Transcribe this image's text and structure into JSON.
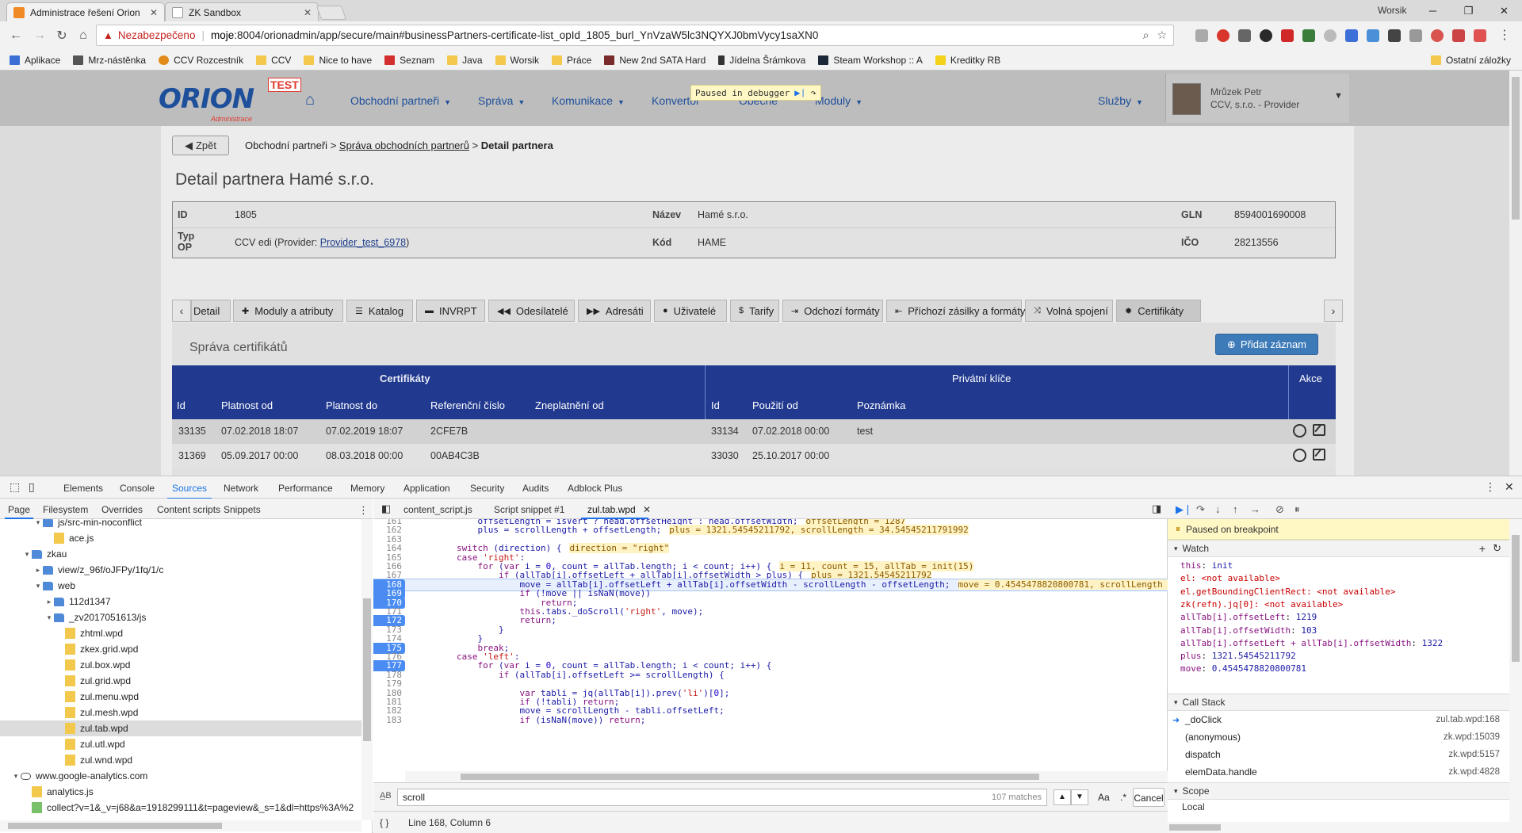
{
  "browser": {
    "tabs": [
      {
        "title": "Administrace řešení Orion",
        "active": true
      },
      {
        "title": "ZK Sandbox",
        "active": false
      }
    ],
    "profile": "Worsik",
    "omnibox": {
      "security_label": "Nezabezpečeno",
      "url_host": "moje",
      "url_rest": ":8004/orionadmin/app/secure/main#businessPartners-certificate-list_opId_1805_burl_YnVzaW5lc3NQYXJ0bmVycy1saXN0"
    },
    "bookmarks": [
      {
        "label": "Aplikace",
        "icon": "apps-icon"
      },
      {
        "label": "Mrz-nástěnka",
        "icon": "pin-icon"
      },
      {
        "label": "CCV Rozcestník",
        "icon": "ccv-icon"
      },
      {
        "label": "CCV",
        "icon": "folder-icon"
      },
      {
        "label": "Nice to have",
        "icon": "folder-icon"
      },
      {
        "label": "Seznam",
        "icon": "seznam-icon"
      },
      {
        "label": "Java",
        "icon": "folder-icon"
      },
      {
        "label": "Worsik",
        "icon": "folder-icon"
      },
      {
        "label": "Práce",
        "icon": "folder-icon"
      },
      {
        "label": "New 2nd SATA Hard",
        "icon": "store-icon"
      },
      {
        "label": "Jídelna Šrámkova",
        "icon": "fork-icon"
      },
      {
        "label": "Steam Workshop :: A",
        "icon": "steam-icon"
      },
      {
        "label": "Kreditky RB",
        "icon": "rb-icon"
      }
    ],
    "other_bookmarks": "Ostatní záložky"
  },
  "app": {
    "logo_text": "ORION",
    "logo_badge": "TEST",
    "logo_sub": "Administrace",
    "menu": [
      {
        "label": "Obchodní partneři"
      },
      {
        "label": "Správa"
      },
      {
        "label": "Komunikace"
      },
      {
        "label": "Konvertor"
      },
      {
        "label": "Obecné"
      },
      {
        "label": "Moduly"
      },
      {
        "label": "Služby"
      }
    ],
    "debugger_overlay": "Paused in debugger",
    "user": {
      "name": "Mrůzek Petr",
      "company": "CCV, s.r.o. - Provider"
    },
    "back_label": "Zpět",
    "breadcrumb": {
      "a": "Obchodní partneři",
      "sep1": " > ",
      "b": "Správa obchodních partnerů",
      "sep2": " > ",
      "c": "Detail partnera"
    },
    "page_title": "Detail partnera Hamé s.r.o.",
    "info": {
      "id_label": "ID",
      "id_value": "1805",
      "name_label": "Název",
      "name_value": "Hamé s.r.o.",
      "gln_label": "GLN",
      "gln_value": "8594001690008",
      "type_label": "Typ OP",
      "type_value": "CCV edi (Provider: ",
      "type_link": "Provider_test_6978",
      "type_end": ")",
      "code_label": "Kód",
      "code_value": "HAME",
      "ico_label": "IČO",
      "ico_value": "28213556"
    },
    "tabs": [
      {
        "label": "Detail",
        "icon": "info-icon"
      },
      {
        "label": "Moduly a atributy",
        "icon": "puzzle-icon"
      },
      {
        "label": "Katalog",
        "icon": "list-icon"
      },
      {
        "label": "INVRPT",
        "icon": "inbox-icon"
      },
      {
        "label": "Odesílatelé",
        "icon": "backward-icon"
      },
      {
        "label": "Adresáti",
        "icon": "forward-icon"
      },
      {
        "label": "Uživatelé",
        "icon": "user-icon"
      },
      {
        "label": "Tarify",
        "icon": "dollar-icon"
      },
      {
        "label": "Odchozí formáty",
        "icon": "signout-icon"
      },
      {
        "label": "Příchozí zásilky a formáty",
        "icon": "signin-icon"
      },
      {
        "label": "Volná spojení",
        "icon": "shuffle-icon"
      },
      {
        "label": "Certifikáty",
        "icon": "cert-icon"
      }
    ],
    "cert": {
      "title": "Správa certifikátů",
      "add_label": "Přidat záznam",
      "group_cert": "Certifikáty",
      "group_keys": "Privátní klíče",
      "group_actions": "Akce",
      "cols_cert": [
        "Id",
        "Platnost od",
        "Platnost do",
        "Referenční číslo",
        "Zneplatnění od"
      ],
      "cols_keys": [
        "Id",
        "Použití od",
        "Poznámka"
      ],
      "rows": [
        {
          "id": "33135",
          "from": "07.02.2018 18:07",
          "to": "07.02.2019 18:07",
          "ref": "2CFE7B",
          "inval": "",
          "kid": "33134",
          "used": "07.02.2018 00:00",
          "note": "test"
        },
        {
          "id": "31369",
          "from": "05.09.2017 00:00",
          "to": "08.03.2018 00:00",
          "ref": "00AB4C3B",
          "inval": "",
          "kid": "33030",
          "used": "25.10.2017 00:00",
          "note": ""
        }
      ]
    }
  },
  "devtools": {
    "tabs": [
      "Elements",
      "Console",
      "Sources",
      "Network",
      "Performance",
      "Memory",
      "Application",
      "Security",
      "Audits",
      "Adblock Plus"
    ],
    "nav_tabs": [
      "Page",
      "Filesystem",
      "Overrides",
      "Content scripts",
      "Snippets"
    ],
    "tree": [
      {
        "label": "js/src-min-noconflict",
        "type": "dir",
        "indent": 3,
        "arrow": "▾"
      },
      {
        "label": "ace.js",
        "type": "file",
        "indent": 4,
        "arrow": ""
      },
      {
        "label": "zkau",
        "type": "dir",
        "indent": 2,
        "arrow": "▾"
      },
      {
        "label": "view/z_96f/oJFPy/1fq/1/c",
        "type": "dir",
        "indent": 3,
        "arrow": "▸"
      },
      {
        "label": "web",
        "type": "dir",
        "indent": 3,
        "arrow": "▾"
      },
      {
        "label": "112d1347",
        "type": "dir",
        "indent": 4,
        "arrow": "▸"
      },
      {
        "label": "_zv2017051613/js",
        "type": "dir",
        "indent": 4,
        "arrow": "▾"
      },
      {
        "label": "zhtml.wpd",
        "type": "file",
        "indent": 5,
        "arrow": ""
      },
      {
        "label": "zkex.grid.wpd",
        "type": "file",
        "indent": 5,
        "arrow": ""
      },
      {
        "label": "zul.box.wpd",
        "type": "file",
        "indent": 5,
        "arrow": ""
      },
      {
        "label": "zul.grid.wpd",
        "type": "file",
        "indent": 5,
        "arrow": ""
      },
      {
        "label": "zul.menu.wpd",
        "type": "file",
        "indent": 5,
        "arrow": ""
      },
      {
        "label": "zul.mesh.wpd",
        "type": "file",
        "indent": 5,
        "arrow": ""
      },
      {
        "label": "zul.tab.wpd",
        "type": "file",
        "indent": 5,
        "arrow": "",
        "selected": true
      },
      {
        "label": "zul.utl.wpd",
        "type": "file",
        "indent": 5,
        "arrow": ""
      },
      {
        "label": "zul.wnd.wpd",
        "type": "file",
        "indent": 5,
        "arrow": ""
      },
      {
        "label": "www.google-analytics.com",
        "type": "cloud",
        "indent": 1,
        "arrow": "▾"
      },
      {
        "label": "analytics.js",
        "type": "file",
        "indent": 2,
        "arrow": ""
      },
      {
        "label": "collect?v=1&_v=j68&a=1918299111&t=pageview&_s=1&dl=https%3A%2",
        "type": "green",
        "indent": 2,
        "arrow": ""
      }
    ],
    "editor_tabs": [
      "content_script.js",
      "Script snippet #1",
      "zul.tab.wpd"
    ],
    "code": [
      {
        "n": "161",
        "t": "            offsetLength = isVert ? head.offsetHeight : head.offsetWidth;",
        "i": "offsetLength = 1287"
      },
      {
        "n": "162",
        "t": "            plus = scrollLength + offsetLength;",
        "i": "plus = 1321.54545211792, scrollLength = 34.54545211791992"
      },
      {
        "n": "163",
        "t": "",
        "i": ""
      },
      {
        "n": "164",
        "t": "        switch (direction) {",
        "i": "direction = \"right\""
      },
      {
        "n": "165",
        "t": "        case 'right':",
        "i": ""
      },
      {
        "n": "166",
        "t": "            for (var i = 0, count = allTab.length; i < count; i++) {",
        "i": "i = 11, count = 15, allTab = init(15)"
      },
      {
        "n": "167",
        "t": "                if (allTab[i].offsetLeft + allTab[i].offsetWidth > plus) {",
        "i": "plus = 1321.54545211792"
      },
      {
        "n": "168",
        "t": "                    move = allTab[i].offsetLeft + allTab[i].offsetWidth - scrollLength - offsetLength;",
        "i": "move = 0.4545478820800781, scrollLength ="
      },
      {
        "n": "169",
        "t": "                    if (!move || isNaN(move))",
        "i": "",
        "bp": true,
        "cur": true
      },
      {
        "n": "170",
        "t": "                        return;",
        "i": "",
        "bp": true
      },
      {
        "n": "171",
        "t": "                    this.tabs._doScroll('right', move);",
        "i": ""
      },
      {
        "n": "172",
        "t": "                    return;",
        "i": "",
        "bp": true
      },
      {
        "n": "173",
        "t": "                }",
        "i": ""
      },
      {
        "n": "174",
        "t": "            }",
        "i": ""
      },
      {
        "n": "175",
        "t": "            break;",
        "i": "",
        "bp": true
      },
      {
        "n": "176",
        "t": "        case 'left':",
        "i": ""
      },
      {
        "n": "177",
        "t": "            for (var i = 0, count = allTab.length; i < count; i++) {",
        "i": "",
        "bp": true
      },
      {
        "n": "178",
        "t": "                if (allTab[i].offsetLeft >= scrollLength) {",
        "i": ""
      },
      {
        "n": "179",
        "t": "",
        "i": ""
      },
      {
        "n": "180",
        "t": "                    var tabli = jq(allTab[i]).prev('li')[0];",
        "i": ""
      },
      {
        "n": "181",
        "t": "                    if (!tabli) return;",
        "i": ""
      },
      {
        "n": "182",
        "t": "                    move = scrollLength - tabli.offsetLeft;",
        "i": ""
      },
      {
        "n": "183",
        "t": "                    if (isNaN(move)) return;",
        "i": ""
      }
    ],
    "search": {
      "value": "scroll",
      "matches": "107 matches",
      "case": "Aa",
      "regex": ".*",
      "cancel": "Cancel"
    },
    "status": "Line 168, Column 6",
    "paused_label": "Paused on breakpoint",
    "watch_title": "Watch",
    "watch": [
      {
        "k": "this",
        "v": "init",
        "na": false
      },
      {
        "k": "el",
        "v": "<not available>",
        "na": true
      },
      {
        "k": "el.getBoundingClientRect",
        "v": "<not available>",
        "na": true
      },
      {
        "k": "zk(refn).jq[0]",
        "v": "<not available>",
        "na": true
      },
      {
        "k": "allTab[i].offsetLeft",
        "v": "1219",
        "na": false
      },
      {
        "k": "allTab[i].offsetWidth",
        "v": "103",
        "na": false
      },
      {
        "k": "allTab[i].offsetLeft + allTab[i].offsetWidth",
        "v": "1322",
        "na": false
      },
      {
        "k": "plus",
        "v": "1321.54545211792",
        "na": false
      },
      {
        "k": "move",
        "v": "0.4545478820800781",
        "na": false
      }
    ],
    "callstack_title": "Call Stack",
    "callstack": [
      {
        "fn": "_doClick",
        "loc": "zul.tab.wpd:168"
      },
      {
        "fn": "(anonymous)",
        "loc": "zk.wpd:15039"
      },
      {
        "fn": "dispatch",
        "loc": "zk.wpd:5157"
      },
      {
        "fn": "elemData.handle",
        "loc": "zk.wpd:4828"
      }
    ],
    "scope_title": "Scope",
    "scope_local": "Local"
  }
}
